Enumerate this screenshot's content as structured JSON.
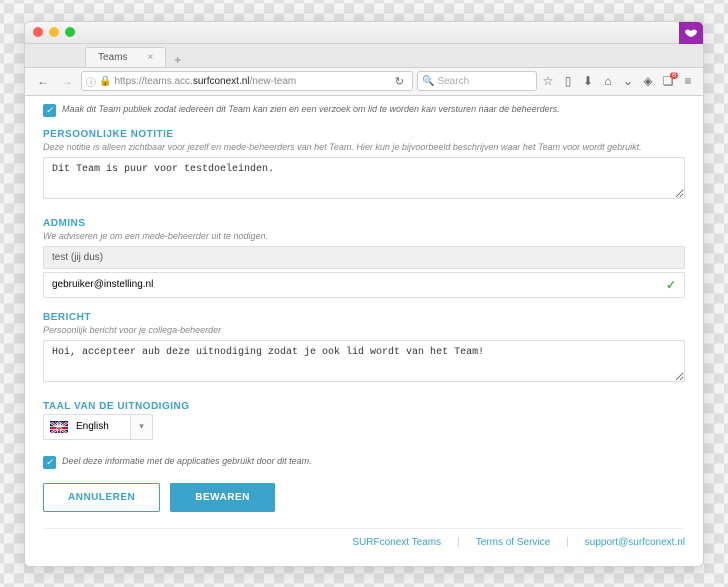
{
  "browser": {
    "tab_title": "Teams",
    "url_prefix": "https://teams.acc.",
    "url_domain": "surfconext.nl",
    "url_path": "/new-team",
    "search_placeholder": "Search"
  },
  "top_checkbox": {
    "label": "Maak dit Team publiek zodat iedereen dit Team kan zien en een verzoek om lid te worden kan versturen naar de beheerders."
  },
  "personal_note": {
    "title": "PERSOONLIJKE NOTITIE",
    "desc": "Deze notitie is alleen zichtbaar voor jezelf en mede-beheerders van het Team. Hier kun je bijvoorbeeld beschrijven waar het Team voor wordt gebruikt.",
    "value": "Dit Team is puur voor testdoeleinden."
  },
  "admins": {
    "title": "ADMINS",
    "desc": "We adviseren je om een mede-beheerder uit te nodigen.",
    "current": "test (jij dus)",
    "input_value": "gebruiker@instelling.nl"
  },
  "message": {
    "title": "BERICHT",
    "desc": "Persoonlijk bericht voor je collega-beheerder",
    "value": "Hoi, accepteer aub deze uitnodiging zodat je ook lid wordt van het Team!"
  },
  "language": {
    "title": "TAAL VAN DE UITNODIGING",
    "selected": "English"
  },
  "share_checkbox": {
    "label": "Deel deze informatie met de applicaties gebruikt door dit team."
  },
  "buttons": {
    "cancel": "ANNULEREN",
    "save": "BEWAREN"
  },
  "footer": {
    "link1": "SURFconext Teams",
    "link2": "Terms of Service",
    "link3": "support@surfconext.nl"
  }
}
